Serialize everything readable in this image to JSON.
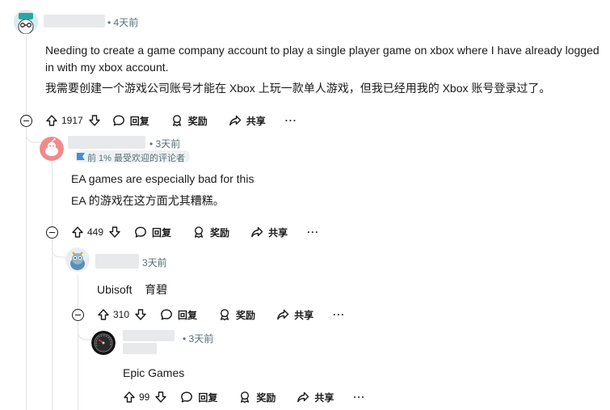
{
  "comments": [
    {
      "time": "• 4天前",
      "text_en_1": "Needing to create a game company account to play a single player game on xbox where I have already logged",
      "text_en_2": "in with my xbox account.",
      "text_zh": "我需要创建一个游戏公司账号才能在 Xbox 上玩一款单人游戏，但我已经用我的 Xbox 账号登录过了。",
      "votes": "1917"
    },
    {
      "time": "• 3天前",
      "badge": "前 1% 最受欢迎的评论者",
      "text_en": "EA games are especially bad for this",
      "text_zh": "EA 的游戏在这方面尤其糟糕。",
      "votes": "449"
    },
    {
      "time": "3天前",
      "text": "Ubisoft    育碧",
      "votes": "310"
    },
    {
      "time": "• 3天前",
      "text": "Epic Games",
      "votes": "99"
    }
  ],
  "actions": {
    "reply": "回复",
    "award": "奖励",
    "share": "共享",
    "more": "···"
  },
  "icons": {
    "upvote": "upvote-arrow-icon",
    "downvote": "downvote-arrow-icon",
    "reply": "speech-bubble-icon",
    "award": "award-ribbon-icon",
    "share": "share-arrow-icon",
    "collapse": "collapse-minus-icon"
  },
  "colors": {
    "thread_line": "#e0e3e6",
    "meta_text": "#576f76",
    "badge_bg": "#eef1f3"
  }
}
